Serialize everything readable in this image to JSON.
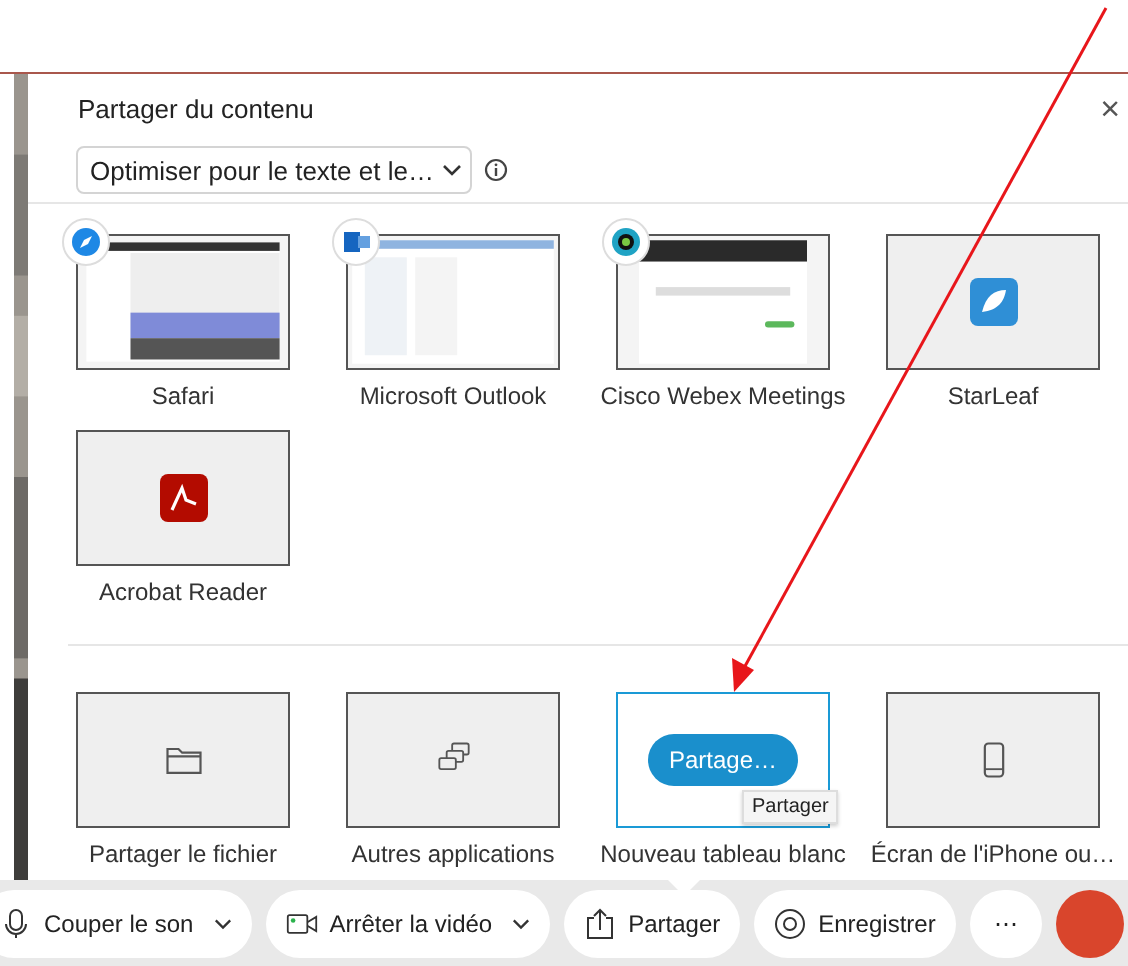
{
  "dialog": {
    "title": "Partager du contenu",
    "close": "×",
    "optimize": {
      "value": "Optimiser pour le texte et le…"
    },
    "apps": [
      {
        "name": "Safari",
        "kind": "thumbnail"
      },
      {
        "name": "Microsoft Outlook",
        "kind": "thumbnail"
      },
      {
        "name": "Cisco Webex Meetings",
        "kind": "thumbnail"
      },
      {
        "name": "StarLeaf",
        "kind": "icon"
      },
      {
        "name": "Acrobat Reader",
        "kind": "icon"
      }
    ],
    "options": [
      {
        "name": "Partager le fichier",
        "selected": false
      },
      {
        "name": "Autres applications",
        "selected": false
      },
      {
        "name": "Nouveau tableau blanc",
        "selected": true,
        "action": "Partage…",
        "tooltip": "Partager"
      },
      {
        "name": "Écran de l'iPhone ou…",
        "selected": false
      }
    ]
  },
  "toolbar": [
    {
      "label": "Couper le son",
      "dropdown": true
    },
    {
      "label": "Arrêter la vidéo",
      "dropdown": true
    },
    {
      "label": "Partager",
      "dropdown": false
    },
    {
      "label": "Enregistrer",
      "dropdown": false
    },
    {
      "label": "⋯",
      "dropdown": false
    }
  ]
}
